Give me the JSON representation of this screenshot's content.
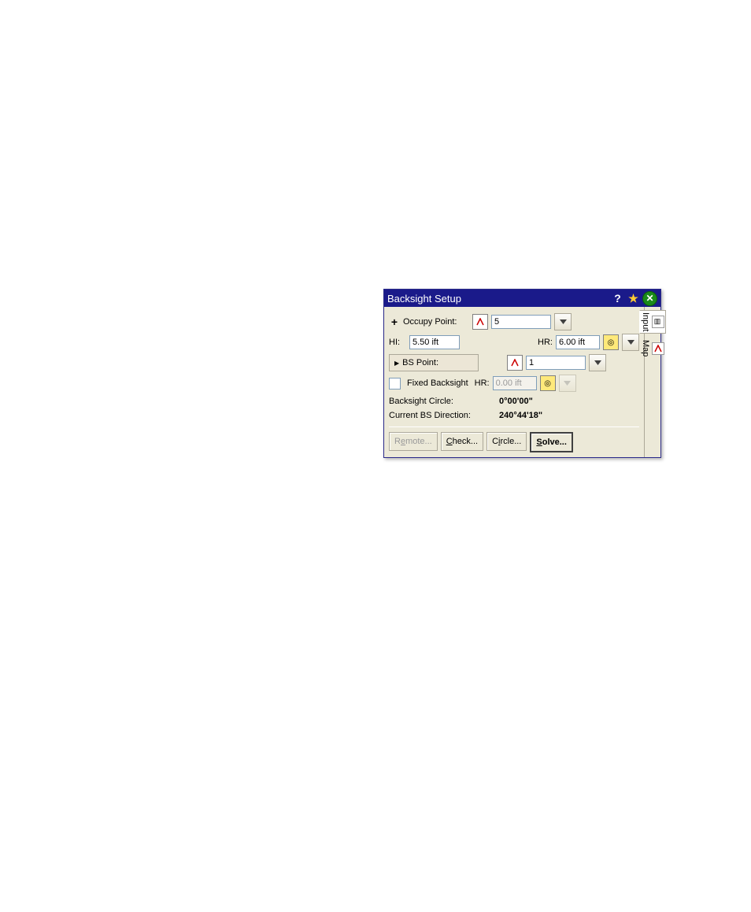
{
  "dialog": {
    "title": "Backsight Setup",
    "titlebar_buttons": {
      "help": "?",
      "star": "★",
      "close": "✕"
    }
  },
  "sidetabs": {
    "input": "Input",
    "map": "Map"
  },
  "occupy": {
    "label": "Occupy Point:",
    "value": "5"
  },
  "hi": {
    "label": "HI:",
    "value": "5.50 ift"
  },
  "hr": {
    "label": "HR:",
    "value": "6.00 ift"
  },
  "bs_point": {
    "button": "BS Point:",
    "value": "1"
  },
  "fixed_backsight": {
    "label": "Fixed Backsight",
    "hr_label": "HR:",
    "hr_value": "0.00 ift"
  },
  "backsight_circle": {
    "label": "Backsight Circle:",
    "value": "0°00'00\""
  },
  "current_bs_direction": {
    "label": "Current BS Direction:",
    "value": "240°44'18\""
  },
  "buttons": {
    "remote": "Remote...",
    "check": "Check...",
    "circle": "Circle...",
    "solve": "Solve..."
  }
}
